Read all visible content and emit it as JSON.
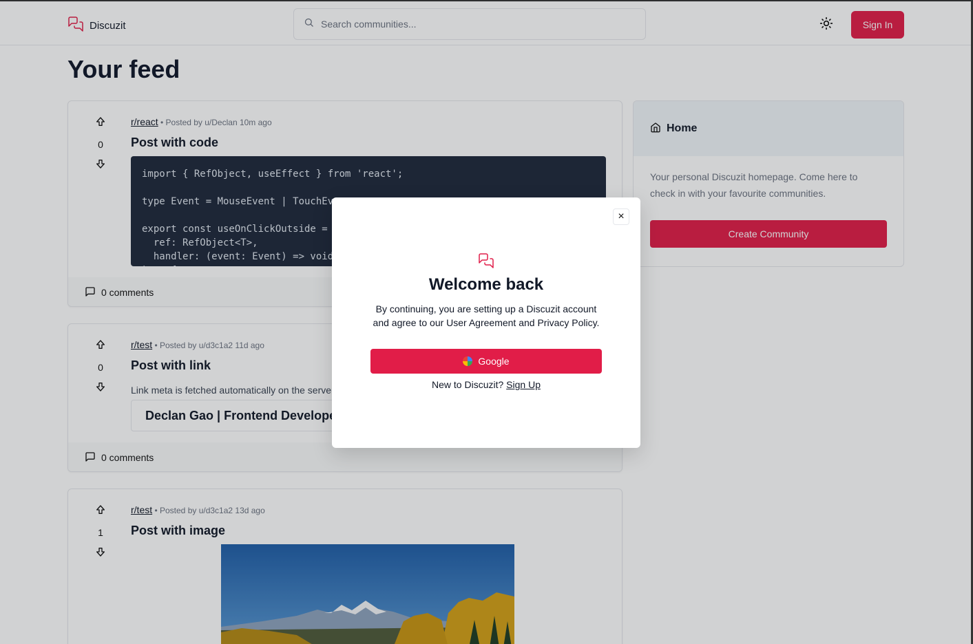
{
  "header": {
    "logo_text": "Discuzit",
    "search_placeholder": "Search communities...",
    "signin_label": "Sign In"
  },
  "page_title": "Your feed",
  "posts": [
    {
      "subreddit": "r/react",
      "meta": " • Posted by u/Declan 10m ago",
      "votes": "0",
      "title": "Post with code",
      "code": "import { RefObject, useEffect } from 'react';\n\ntype Event = MouseEvent | TouchEvent;\n\nexport const useOnClickOutside = <T extends HTMLElement = HTMLElement>(\n  ref: RefObject<T>,\n  handler: (event: Event) => void\n) => {",
      "comments": "0 comments"
    },
    {
      "subreddit": "r/test",
      "meta": " • Posted by u/d3c1a2 11d ago",
      "votes": "0",
      "title": "Post with link",
      "description": "Link meta is fetched automatically on the server.",
      "link_title": "Declan Gao | Frontend Developer",
      "comments": "0 comments"
    },
    {
      "subreddit": "r/test",
      "meta": " • Posted by u/d3c1a2 13d ago",
      "votes": "1",
      "title": "Post with image"
    }
  ],
  "sidebar": {
    "title": "Home",
    "description": "Your personal Discuzit homepage. Come here to check in with your favourite communities.",
    "create_label": "Create Community"
  },
  "modal": {
    "close_symbol": "×",
    "title": "Welcome back",
    "text": "By continuing, you are setting up a Discuzit account and agree to our User Agreement and Privacy Policy.",
    "google_label": "Google",
    "signup_prompt": "New to Discuzit?",
    "signup_link": "Sign Up"
  },
  "colors": {
    "accent": "#e11d48",
    "code_bg": "#1e293b"
  }
}
